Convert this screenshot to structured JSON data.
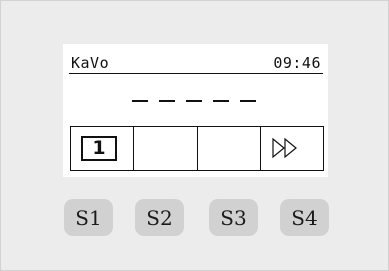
{
  "display": {
    "brand": "KaVo",
    "time": "09:46",
    "entry_dashes": 5,
    "softkeys": {
      "key1_program": "1",
      "key2": "",
      "key3": "",
      "key4_icon": "fast-forward-outline-icon"
    }
  },
  "buttons": [
    {
      "label": "S1"
    },
    {
      "label": "S2"
    },
    {
      "label": "S3"
    },
    {
      "label": "S4"
    }
  ],
  "colors": {
    "panel": "#ececec",
    "button": "#d1d1d1",
    "screen": "#ffffff",
    "ink": "#111111"
  }
}
